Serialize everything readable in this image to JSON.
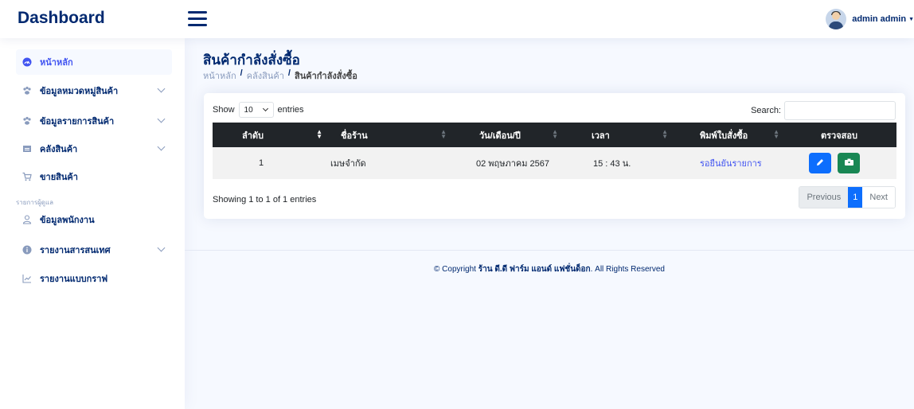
{
  "brand": "Dashboard",
  "user": {
    "name": "admin admin"
  },
  "sidebar": {
    "items": [
      {
        "label": "หน้าหลัก",
        "icon": "dashboard-icon",
        "active": true
      },
      {
        "label": "ข้อมูลหมวดหมู่สินค้า",
        "icon": "category-icon"
      },
      {
        "label": "ข้อมูลรายการสินค้า",
        "icon": "product-list-icon"
      },
      {
        "label": "คลังสินค้า",
        "icon": "warehouse-icon"
      },
      {
        "label": "ขายสินค้า",
        "icon": "cart-icon"
      },
      {
        "label": "ข้อมูลพนักงาน",
        "icon": "person-icon"
      },
      {
        "label": "รายงานสารสนเทศ",
        "icon": "info-icon"
      },
      {
        "label": "รายงานแบบกราฟ",
        "icon": "line-chart-icon"
      }
    ],
    "heading": "รายการผู้ดูแล"
  },
  "page": {
    "title": "สินค้ากำลังสั่งซื้อ",
    "breadcrumb": [
      "หน้าหลัก",
      "คลังสินค้า",
      "สินค้ากำลังสั่งซื้อ"
    ],
    "sep": "/"
  },
  "table": {
    "show_label": "Show",
    "entries_label": "entries",
    "page_length": "10",
    "search_label": "Search:",
    "columns": [
      "ลำดับ",
      "ชื่อร้าน",
      "วัน/เดือน/ปี",
      "เวลา",
      "พิมพ์ใบสั่งซื้อ",
      "ตรวจสอบ"
    ],
    "rows": [
      {
        "no": "1",
        "shop": "เมษจำกัด",
        "date": "02 พฤษภาคม 2567",
        "time": "15 : 43 น.",
        "status": "รอยืนยันรายการ"
      }
    ],
    "info": "Showing 1 to 1 of 1 entries",
    "pagination": {
      "previous": "Previous",
      "current": "1",
      "next": "Next"
    }
  },
  "footer": {
    "prefix": "© Copyright ",
    "company": "ร้าน ดี.ดี ฟาร์ม แอนด์ แฟชั่นด็อก",
    "suffix": ". All Rights Reserved"
  },
  "colors": {
    "primary": "#4154f1",
    "navy": "#012970",
    "edit": "#0d6efd",
    "check": "#198754",
    "header": "#212529"
  }
}
